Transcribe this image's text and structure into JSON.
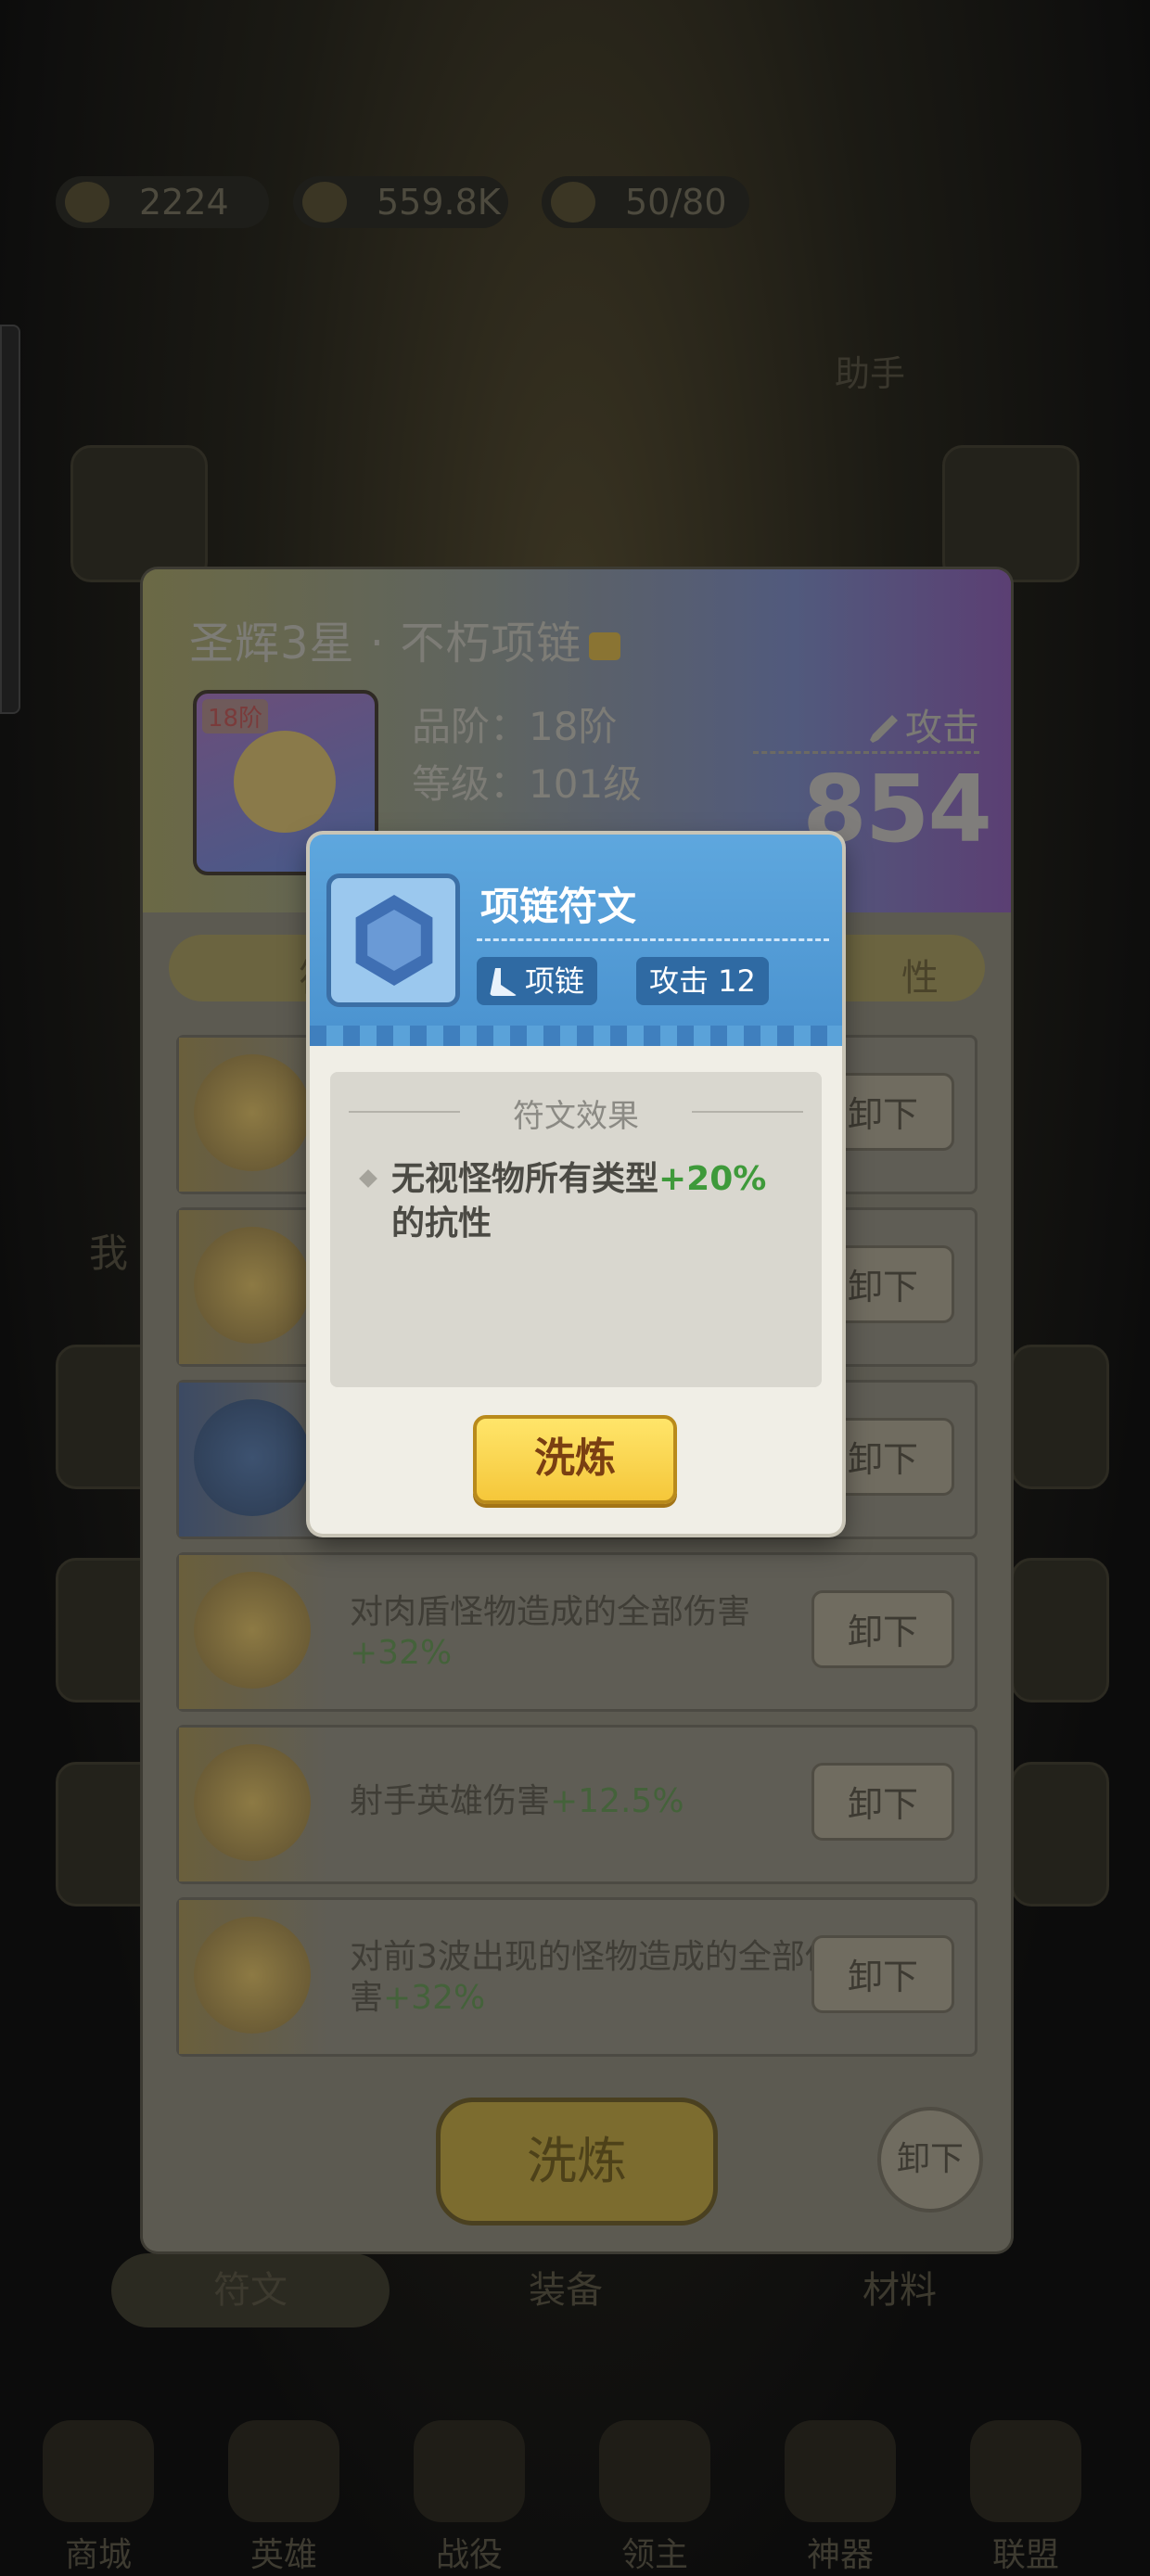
{
  "top_bar": {
    "gems": "2224",
    "gold": "559.8K",
    "stamina": "50/80"
  },
  "background": {
    "top_right_label": "助手",
    "left_label": "我",
    "bottom_tabs": [
      "符文",
      "装备",
      "材料"
    ],
    "nav": [
      "商城",
      "英雄",
      "战役",
      "领主",
      "神器",
      "联盟"
    ]
  },
  "panel": {
    "title": "圣辉3星 · 不朽项链",
    "tier_badge": "18阶",
    "stat_rank": "品阶：18阶",
    "stat_level": "等级：101级",
    "attack_label": "攻击",
    "attack_value": "854",
    "tab_left": "符",
    "tab_right": "性",
    "rows": [
      {
        "desc": "",
        "plus": "",
        "unload": "卸下"
      },
      {
        "desc": "",
        "plus": "",
        "unload": "卸下"
      },
      {
        "desc": "",
        "plus": "",
        "unload": "卸下"
      },
      {
        "desc": "对肉盾怪物造成的全部伤害",
        "plus": "+32%",
        "unload": "卸下"
      },
      {
        "desc": "射手英雄伤害",
        "plus": "+12.5%",
        "unload": "卸下"
      },
      {
        "desc": "对前3波出现的怪物造成的全部伤害",
        "plus": "+32%",
        "unload": "卸下"
      }
    ],
    "refine_label": "洗炼",
    "unload_all_label": "卸下"
  },
  "popup": {
    "name": "项链符文",
    "slot_tag": "项链",
    "attack_tag": "攻击 12",
    "effect_title": "符文效果",
    "effect_text_a": "无视怪物所有类型",
    "effect_plus": "+20%",
    "effect_text_b": "的抗性",
    "refine_label": "洗炼"
  },
  "colors": {
    "popup_header": "#4a92cf",
    "refine_button": "#f5c73a",
    "bonus_green": "#3e9a3a"
  }
}
